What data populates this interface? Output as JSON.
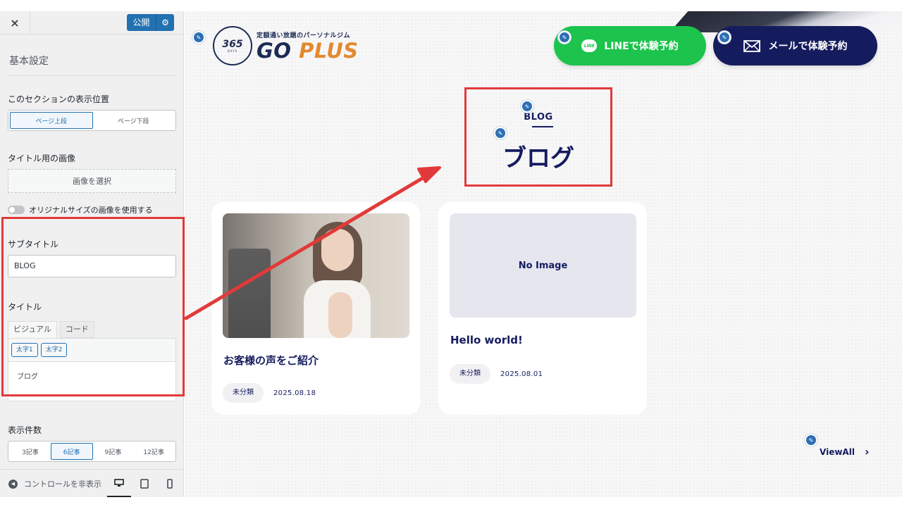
{
  "sidebar": {
    "close_icon": "×",
    "publish_label": "公開",
    "settings_icon": "gear-icon",
    "section_title": "基本設定",
    "position_control": {
      "label": "このセクションの表示位置",
      "options": [
        "ページ上段",
        "ページ下段"
      ],
      "selected": "ページ上段"
    },
    "title_image": {
      "label": "タイトル用の画像",
      "button": "画像を選択"
    },
    "original_size_toggle": "オリジナルサイズの画像を使用する",
    "subtitle_control": {
      "label": "サブタイトル",
      "value": "BLOG"
    },
    "title_control": {
      "label": "タイトル",
      "tabs": [
        "ビジュアル",
        "コード"
      ],
      "active_tab": "ビジュアル",
      "toolbar_buttons": [
        "太字1",
        "太字2"
      ],
      "content": "ブログ"
    },
    "count_control": {
      "label": "表示件数",
      "options": [
        "3記事",
        "6記事",
        "9記事",
        "12記事"
      ],
      "selected": "6記事"
    },
    "footer": {
      "collapse_label": "コントロールを非表示",
      "devices": [
        "desktop-icon",
        "tablet-icon",
        "mobile-icon"
      ],
      "active_device": "desktop-icon"
    }
  },
  "preview": {
    "logo": {
      "badge_number": "365",
      "badge_days": "DAYS",
      "tagline": "定額通い放題のパーソナルジム",
      "brand_go": "GO",
      "brand_plus": "PLUS"
    },
    "cta_line": {
      "badge": "LINE",
      "label": "LINEで体験予約"
    },
    "cta_mail": {
      "label": "メールで体験予約"
    },
    "section": {
      "subtitle": "BLOG",
      "title": "ブログ"
    },
    "posts": [
      {
        "title": "お客様の声をご紹介",
        "category": "未分類",
        "date": "2025.08.18",
        "image": "photo"
      },
      {
        "title": "Hello world!",
        "category": "未分類",
        "date": "2025.08.01",
        "image_placeholder": "No Image"
      }
    ],
    "view_all": "ViewAll"
  },
  "colors": {
    "navy": "#151c5e",
    "line_green": "#1cc34c",
    "accent_orange": "#e28a2f",
    "wp_blue": "#2271b1",
    "annotation_red": "#e23a3a"
  }
}
